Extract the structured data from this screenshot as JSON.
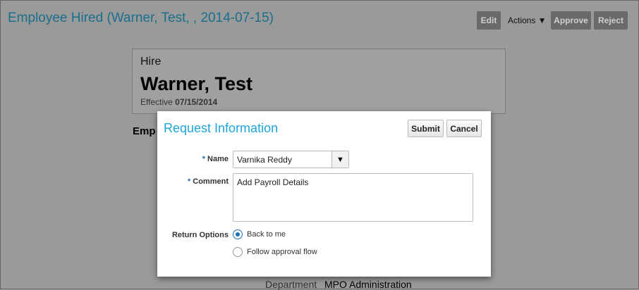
{
  "page": {
    "title": "Employee Hired (Warner, Test, , 2014-07-15)",
    "buttons": {
      "edit": "Edit",
      "actions": "Actions ▼",
      "approve": "Approve",
      "reject": "Reject"
    }
  },
  "card": {
    "type": "Hire",
    "name": "Warner, Test",
    "effective_label": "Effective",
    "effective_date": "07/15/2014"
  },
  "section": {
    "heading_partial": "Emp"
  },
  "detail": {
    "department_label": "Department",
    "department_value": "MPO Administration"
  },
  "dialog": {
    "title": "Request Information",
    "submit": "Submit",
    "cancel": "Cancel",
    "name_label": "Name",
    "name_value": "Varnika Reddy",
    "required_mark": "*",
    "comment_label": "Comment",
    "comment_value": "Add Payroll Details",
    "return_label": "Return Options",
    "return_options": [
      {
        "label": "Back to me",
        "selected": true
      },
      {
        "label": "Follow approval flow",
        "selected": false
      }
    ]
  }
}
